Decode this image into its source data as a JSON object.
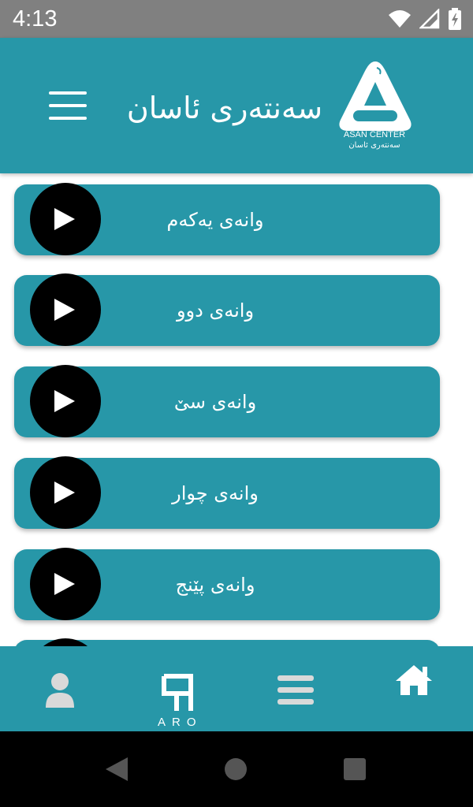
{
  "status_bar": {
    "time": "4:13",
    "icons": [
      "wifi-icon",
      "signal-icon",
      "battery-icon"
    ]
  },
  "header": {
    "title": "سەنتەری ئاسان",
    "logo_caption_en": "ASAN CENTER",
    "logo_caption_ku": "سەنتەری ئاسان",
    "background_color": "#2797a8"
  },
  "lessons": [
    {
      "label": "وانەی یەکەم"
    },
    {
      "label": "وانەی دوو"
    },
    {
      "label": "وانەی سێ"
    },
    {
      "label": "وانەی چوار"
    },
    {
      "label": "وانەی پێنج"
    }
  ],
  "bottom_nav": {
    "items": [
      "profile-icon",
      "aro-logo-icon",
      "list-icon",
      "home-icon"
    ],
    "brand_text": "ARO"
  },
  "system_nav": [
    "back-icon",
    "home-circle-icon",
    "recents-icon"
  ],
  "colors": {
    "accent": "#2797a8",
    "play_button": "#000000",
    "text": "#ffffff"
  }
}
